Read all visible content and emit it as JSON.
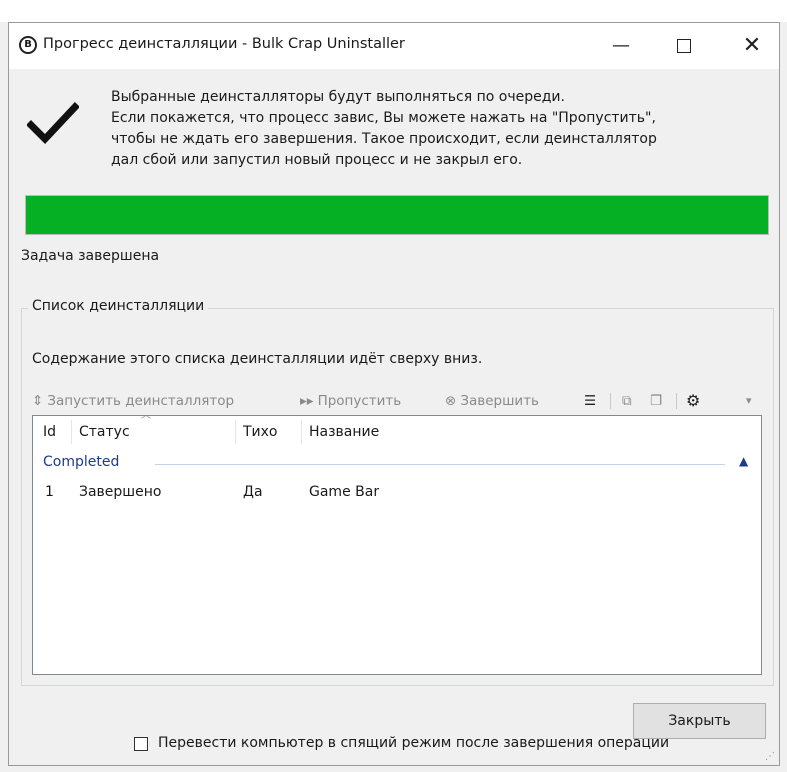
{
  "window": {
    "title": "Прогресс деинсталляции - Bulk Crap Uninstaller",
    "app_icon_letter": "B",
    "controls": {
      "minimize": "—",
      "close": "✕"
    }
  },
  "status_icon": "checkmark-icon",
  "description": [
    "Выбранные деинсталляторы будут выполняться по очереди.",
    "Если покажется, что процесс завис, Вы можете нажать на \"Пропустить\",",
    "чтобы не ждать его завершения. Такое происходит, если деинсталлятор",
    "дал сбой или запустил новый процесс и не закрыл его."
  ],
  "progress": {
    "percent": 100,
    "color": "#06b025"
  },
  "task_status": "Задача завершена",
  "uninstall_list": {
    "group_title": "Список деинсталляции",
    "description": "Содержание этого списка деинсталляции идёт сверху вниз.",
    "toolbar": {
      "run": {
        "label": "Запустить деинсталлятор",
        "icon": "run-arrows-icon"
      },
      "skip": {
        "label": "Пропустить",
        "icon": "skip-forward-icon"
      },
      "terminate": {
        "label": "Завершить",
        "icon": "terminate-x-icon"
      },
      "icons": [
        "list-view-icon",
        "open-external-icon",
        "copy-icon",
        "gear-icon",
        "overflow-icon"
      ]
    },
    "columns": [
      "Id",
      "Статус",
      "Тихо",
      "Название"
    ],
    "groups": [
      {
        "label": "Completed",
        "rows": [
          {
            "id": "1",
            "status": "Завершено",
            "quiet": "Да",
            "name": "Game Bar"
          }
        ]
      }
    ]
  },
  "footer": {
    "close_button": "Закрыть",
    "sleep_checkbox": {
      "label": "Перевести компьютер в спящий режим после завершения операции",
      "checked": false
    }
  },
  "colors": {
    "accent_green": "#06b025",
    "group_header_blue": "#1e3b8a"
  }
}
